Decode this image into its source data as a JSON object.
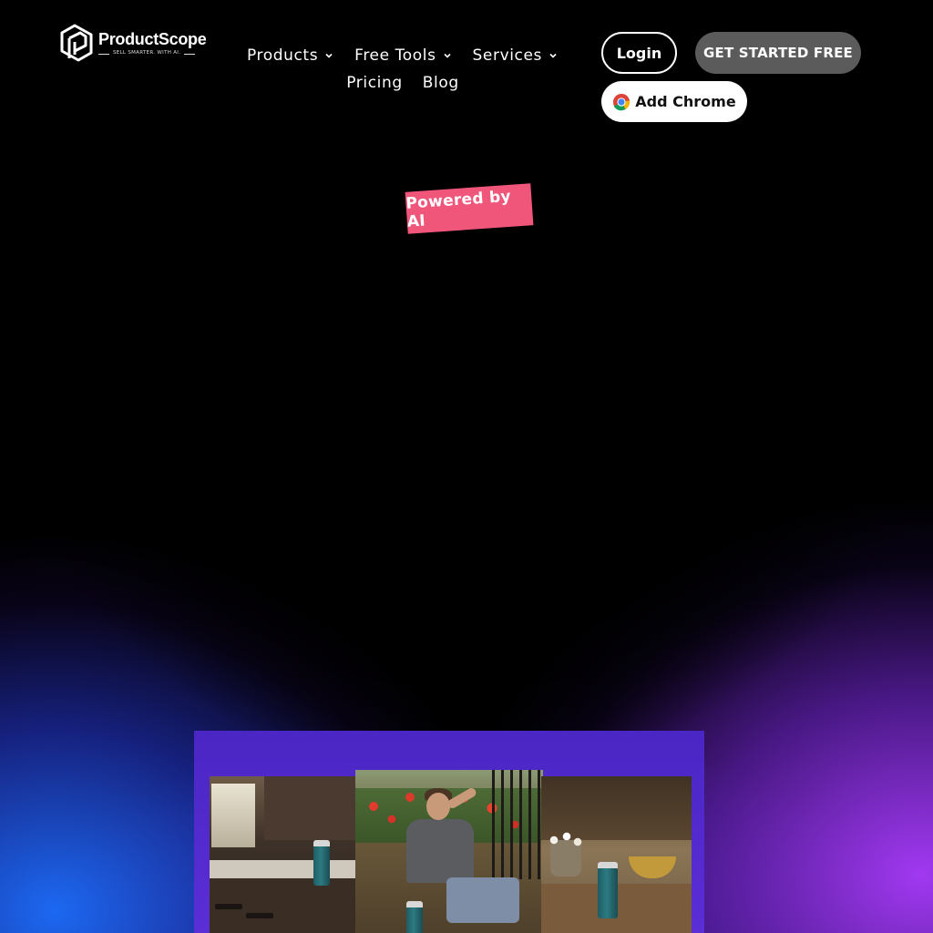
{
  "brand": {
    "name": "ProductScope",
    "tagline": "SELL SMARTER. WITH AI."
  },
  "nav": {
    "items": [
      {
        "label": "Products",
        "has_dropdown": true
      },
      {
        "label": "Free Tools",
        "has_dropdown": true
      },
      {
        "label": "Services",
        "has_dropdown": true
      },
      {
        "label": "Pricing",
        "has_dropdown": false
      },
      {
        "label": "Blog",
        "has_dropdown": false
      }
    ]
  },
  "actions": {
    "login_label": "Login",
    "get_started_label": "GET STARTED FREE",
    "add_chrome_label": "Add Chrome"
  },
  "hero": {
    "badge": "Powered by AI"
  },
  "colors": {
    "background": "#000000",
    "badge": "#f0557a",
    "get_started_bg": "#5b5b5b",
    "glow_left": "#1e6eff",
    "glow_right": "#aa3cff",
    "showcase_bg": "#4a26c4"
  },
  "icons": [
    "productscope-logo-icon",
    "chevron-down-icon",
    "chrome-icon"
  ]
}
